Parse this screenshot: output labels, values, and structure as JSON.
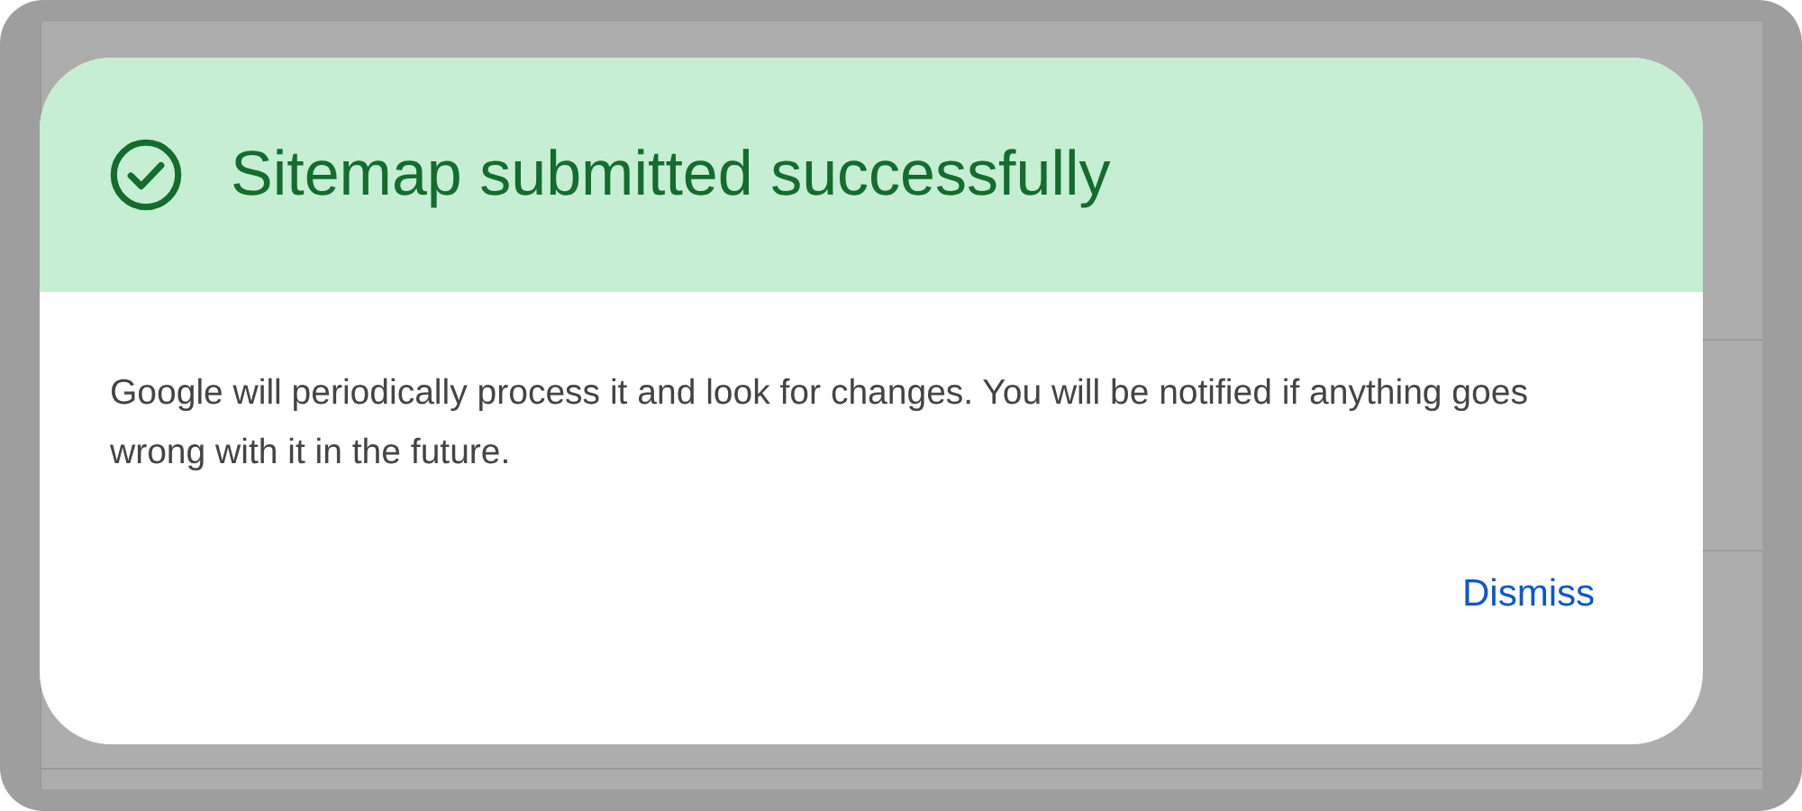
{
  "dialog": {
    "kind": "success",
    "title": "Sitemap submitted successfully",
    "message": "Google will periodically process it and look for changes. You will be notified if anything goes wrong with it in the future.",
    "actions": [
      {
        "label": "Dismiss"
      }
    ]
  }
}
